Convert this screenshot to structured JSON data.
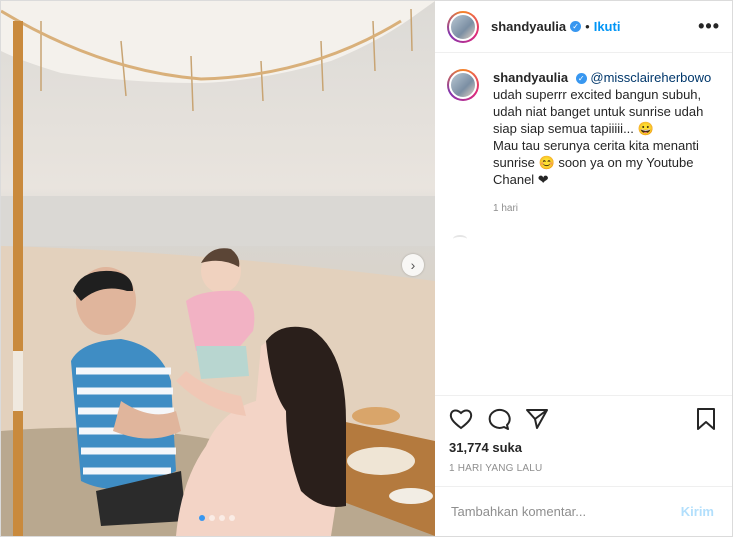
{
  "post": {
    "username": "shandyaulia",
    "separator": "•",
    "follow_label": "Ikuti",
    "more_label": "•••",
    "verified_mark": "✓"
  },
  "caption": {
    "username": "shandyaulia",
    "mention": "@missclaireherbowo",
    "lines": [
      "udah superrr excited bangun subuh,",
      "udah niat banget untuk sunrise udah",
      "siap siap semua tapiiiii... 😀",
      "Mau tau serunya cerita kita menanti",
      "sunrise 😊 soon ya on my Youtube",
      "Chanel ❤"
    ],
    "time": "1 hari"
  },
  "actions": {
    "icons": [
      "heart-icon",
      "comment-icon",
      "share-icon",
      "bookmark-icon"
    ],
    "likes": "31,774 suka",
    "date": "1 HARI YANG LALU"
  },
  "comment": {
    "placeholder": "Tambahkan komentar...",
    "post_label": "Kirim"
  },
  "carousel": {
    "next_icon": "chevron-right-icon",
    "next_glyph": "›",
    "slide_count": 4,
    "active_index": 0
  },
  "colors": {
    "accent": "#0095f6",
    "verified": "#3897f0",
    "post_disabled": "#b2dffc"
  }
}
